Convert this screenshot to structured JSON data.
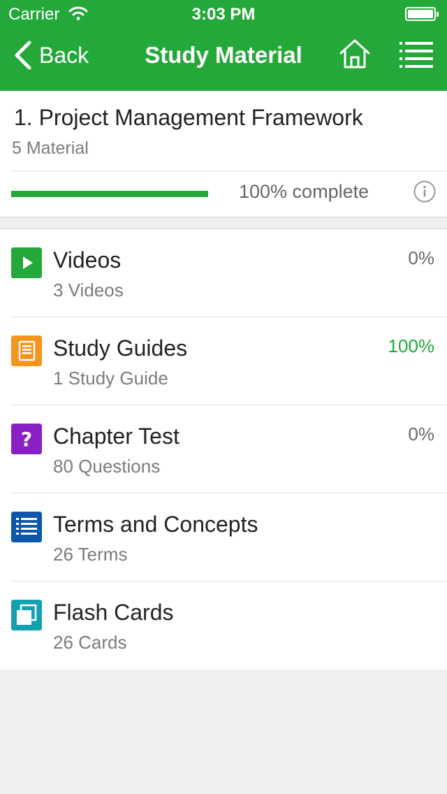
{
  "status_bar": {
    "carrier": "Carrier",
    "time": "3:03 PM"
  },
  "nav": {
    "back_label": "Back",
    "title": "Study Material"
  },
  "chapter": {
    "title": "1. Project Management Framework",
    "subtitle": "5 Material",
    "progress_percent": 100,
    "progress_text": "100% complete"
  },
  "colors": {
    "brand_green": "#24a83a",
    "videos": "#24a83a",
    "study_guides": "#f7941d",
    "chapter_test": "#8a1fc4",
    "terms": "#0c57a8",
    "flash_cards": "#13a0b0"
  },
  "materials": [
    {
      "icon": "play-icon",
      "title": "Videos",
      "subtitle": "3 Videos",
      "percent": "0%"
    },
    {
      "icon": "book-icon",
      "title": "Study Guides",
      "subtitle": "1 Study Guide",
      "percent": "100%"
    },
    {
      "icon": "question-icon",
      "title": "Chapter Test",
      "subtitle": "80 Questions",
      "percent": "0%"
    },
    {
      "icon": "list-icon",
      "title": "Terms and Concepts",
      "subtitle": "26 Terms",
      "percent": ""
    },
    {
      "icon": "cards-icon",
      "title": "Flash Cards",
      "subtitle": "26 Cards",
      "percent": ""
    }
  ]
}
